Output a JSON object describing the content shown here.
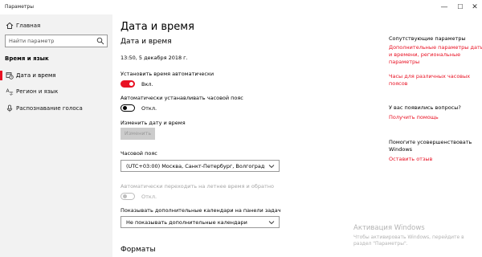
{
  "window": {
    "title": "Параметры",
    "minimize_glyph": "—",
    "maximize_glyph": "☐",
    "close_glyph": "✕"
  },
  "sidebar": {
    "home": {
      "label": "Главная",
      "icon": "home-icon"
    },
    "search_placeholder": "Найти параметр",
    "section_title": "Время и язык",
    "items": [
      {
        "label": "Дата и время",
        "icon": "calendar-clock-icon",
        "active": true
      },
      {
        "label": "Регион и язык",
        "icon": "region-language-icon",
        "active": false
      },
      {
        "label": "Распознавание голоса",
        "icon": "microphone-icon",
        "active": false
      }
    ]
  },
  "main": {
    "page_title": "Дата и время",
    "section_title": "Дата и время",
    "current_datetime": "13:50, 5 декабря 2018 г.",
    "auto_time": {
      "label": "Установить время автоматически",
      "state": "Вкл.",
      "on": true
    },
    "auto_timezone": {
      "label": "Автоматически устанавливать часовой пояс",
      "state": "Откл.",
      "on": false
    },
    "change_datetime": {
      "label": "Изменить дату и время",
      "button": "Изменить"
    },
    "timezone": {
      "label": "Часовой пояс",
      "value": "(UTC+03:00) Москва, Санкт-Петербург, Волгоград"
    },
    "dst": {
      "label": "Автоматически переходить на летнее время и обратно",
      "state": "Откл.",
      "disabled": true
    },
    "extra_calendars": {
      "label": "Показывать дополнительные календари на панели задач",
      "value": "Не показывать дополнительные календари"
    },
    "formats_title": "Форматы"
  },
  "related": {
    "title": "Сопутствующие параметры",
    "link1_line1": "Дополнительные параметры даты",
    "link1_line2": "и времени, региональные",
    "link1_line3": "параметры",
    "link2_line1": "Часы для различных часовых",
    "link2_line2": "поясов",
    "question_title": "У вас появились вопросы?",
    "help_link": "Получить помощь",
    "improve_line1": "Помогите усовершенствовать",
    "improve_line2": "Windows",
    "feedback_link": "Оставить отзыв"
  },
  "watermark": {
    "line1": "Активация Windows",
    "line2": "Чтобы активировать Windows, перейдите в",
    "line3": "раздел \"Параметры\"."
  },
  "colors": {
    "accent": "#e81123",
    "sidebar_bg": "#f2f2f2",
    "disabled_text": "#a6a6a6"
  }
}
